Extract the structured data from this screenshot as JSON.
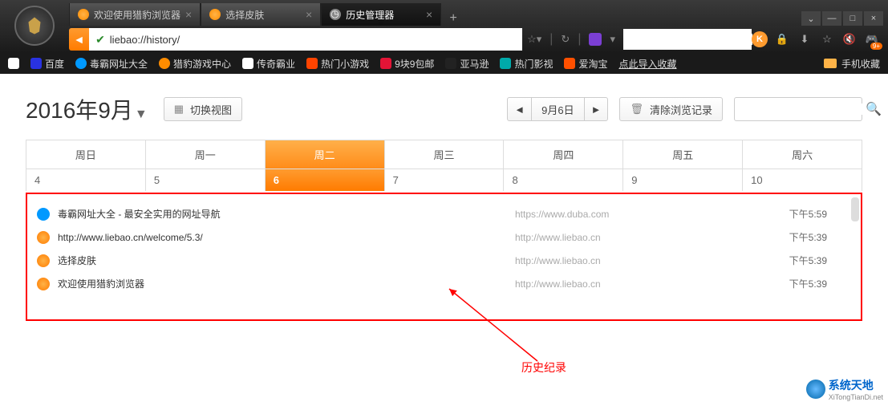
{
  "tabs": [
    {
      "label": "欢迎使用猎豹浏览器",
      "active": false
    },
    {
      "label": "选择皮肤",
      "active": false
    },
    {
      "label": "历史管理器",
      "active": true
    }
  ],
  "winbtns": {
    "restore": "⌄",
    "min": "—",
    "max": "□",
    "close": "×"
  },
  "url": "liebao://history/",
  "toolbar_badge": "9+",
  "bookmarks": [
    {
      "label": "百度",
      "cls": "baidu"
    },
    {
      "label": "毒霸网址大全",
      "cls": "kblue"
    },
    {
      "label": "猎豹游戏中心",
      "cls": "korg"
    },
    {
      "label": "传奇霸业",
      "cls": "doc"
    },
    {
      "label": "热门小游戏",
      "cls": "red"
    },
    {
      "label": "9块9包邮",
      "cls": "jd"
    },
    {
      "label": "亚马逊",
      "cls": "amz"
    },
    {
      "label": "热门影视",
      "cls": "yk"
    },
    {
      "label": "爱淘宝",
      "cls": "tao"
    }
  ],
  "bk_import": "点此导入收藏",
  "bk_mobile": "手机收藏",
  "page": {
    "month": "2016年9月",
    "toggle_view": "切换视图",
    "date_label": "9月6日",
    "clear": "清除浏览记录"
  },
  "dow": [
    "周日",
    "周一",
    "周二",
    "周三",
    "周四",
    "周五",
    "周六"
  ],
  "dow_active": 2,
  "nums": [
    "4",
    "5",
    "6",
    "7",
    "8",
    "9",
    "10"
  ],
  "num_active": 2,
  "history": [
    {
      "fav": "blue",
      "title": "毒霸网址大全 - 最安全实用的网址导航",
      "url": "https://www.duba.com",
      "time": "下午5:59"
    },
    {
      "fav": "org",
      "title": "http://www.liebao.cn/welcome/5.3/",
      "url": "http://www.liebao.cn",
      "time": "下午5:39"
    },
    {
      "fav": "org",
      "title": "选择皮肤",
      "url": "http://www.liebao.cn",
      "time": "下午5:39"
    },
    {
      "fav": "org",
      "title": "欢迎使用猎豹浏览器",
      "url": "http://www.liebao.cn",
      "time": "下午5:39"
    }
  ],
  "annotation": "历史纪录",
  "watermark": {
    "line1": "系统天地",
    "line2": "XiTongTianDi.net"
  }
}
